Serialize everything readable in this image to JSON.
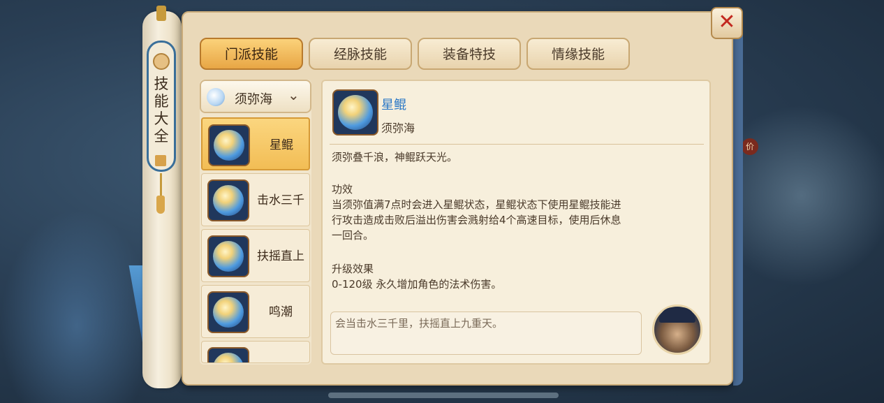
{
  "window": {
    "title": "技能大全",
    "close_label": "✕"
  },
  "tabs": [
    {
      "label": "门派技能",
      "active": true
    },
    {
      "label": "经脉技能",
      "active": false
    },
    {
      "label": "装备特技",
      "active": false
    },
    {
      "label": "情缘技能",
      "active": false
    }
  ],
  "sect_selector": {
    "value": "须弥海",
    "icon": "chevron-down-icon"
  },
  "skills": [
    {
      "name": "星鲲",
      "active": true
    },
    {
      "name": "击水三千",
      "active": false
    },
    {
      "name": "扶摇直上",
      "active": false
    },
    {
      "name": "鸣潮",
      "active": false
    }
  ],
  "detail": {
    "name": "星鲲",
    "sect": "须弥海",
    "flavor": "须弥叠千浪，神鲲跃天光。",
    "effect_title": "功效",
    "effect_lines": [
      "当须弥值满7点时会进入星鲲状态，星鲲状态下使用星鲲技能进",
      "行攻击造成击败后溢出伤害会溅射给4个高速目标，使用后休息",
      "一回合。"
    ],
    "upgrade_title": "升级效果",
    "upgrade_text": "0-120级  永久增加角色的法术伤害。"
  },
  "quote": "会当击水三千里，扶摇直上九重天。",
  "background_badge": "价",
  "colors": {
    "accent": "#e8a645",
    "skill_name": "#2b78c6",
    "close": "#c2281f"
  }
}
